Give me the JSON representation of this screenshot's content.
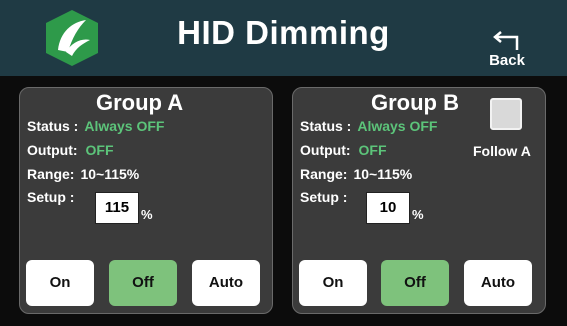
{
  "header": {
    "title": "HID  Dimming",
    "back_label": "Back"
  },
  "status_label": "Status :",
  "output_label": "Output:",
  "range_label": "Range:",
  "setup_label": "Setup :",
  "unit": "%",
  "group_a": {
    "title": "Group A",
    "status": "Always OFF",
    "output": "OFF",
    "range": "10~115%",
    "setup_value": "115",
    "buttons": {
      "on": "On",
      "off": "Off",
      "auto": "Auto"
    }
  },
  "group_b": {
    "title": "Group B",
    "status": "Always OFF",
    "output": "OFF",
    "range": "10~115%",
    "setup_value": "10",
    "follow_label": "Follow A",
    "buttons": {
      "on": "On",
      "off": "Off",
      "auto": "Auto"
    }
  },
  "colors": {
    "header_bg": "#1f3a44",
    "status_green": "#5cc47a",
    "active_button": "#7ec27c",
    "logo_green": "#2e9a4a"
  },
  "icons": {
    "logo": "leaf-logo-icon",
    "back": "back-arrow-icon"
  }
}
